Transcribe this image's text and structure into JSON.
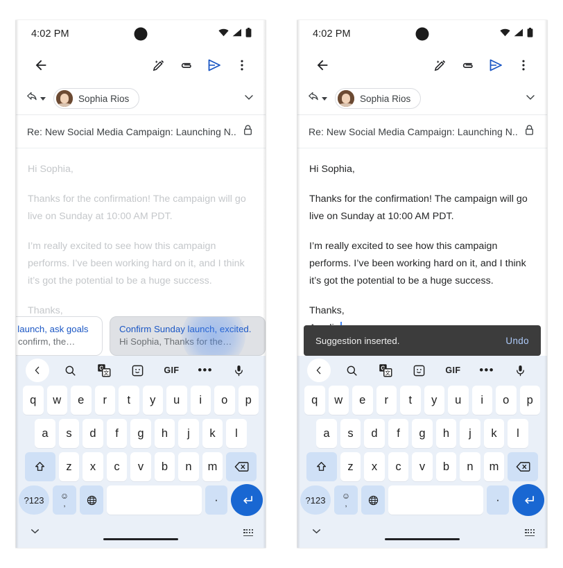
{
  "status_bar": {
    "time": "4:02 PM",
    "icons": [
      "wifi-icon",
      "cellular-signal-icon",
      "battery-icon"
    ]
  },
  "app_bar": {
    "back_icon": "arrow-back-icon",
    "actions": [
      {
        "name": "ai-compose-icon",
        "label": ""
      },
      {
        "name": "attach-file-icon",
        "label": ""
      },
      {
        "name": "send-icon",
        "label": ""
      },
      {
        "name": "more-options-icon",
        "label": ""
      }
    ]
  },
  "compose": {
    "reply_icon": "reply-icon",
    "recipient": {
      "name": "Sophia Rios",
      "avatar": "contact-avatar"
    },
    "expand_icon": "chevron-down-icon",
    "subject": "Re: New Social Media Campaign: Launching N...",
    "lock_icon": "lock-icon"
  },
  "email_body": {
    "greeting": "Hi Sophia,",
    "paragraph_1": "Thanks for the confirmation! The campaign will go live on Sunday at 10:00 AM PDT.",
    "paragraph_2": "I’m really excited to see how this campaign performs. I’ve been working hard on it, and I think it’s got the potential to be a huge success.",
    "closing": "Thanks,",
    "signature": "Amelia"
  },
  "suggestions": [
    {
      "title": "y launch, ask goals",
      "subtitle": "o confirm, the…",
      "state": "partially-visible"
    },
    {
      "title": "Confirm Sunday launch, excited.",
      "subtitle": "Hi Sophia, Thanks for the…",
      "state": "pressed"
    }
  ],
  "snackbar": {
    "message": "Suggestion inserted.",
    "action_label": "Undo"
  },
  "keyboard": {
    "toolbar": [
      {
        "name": "chevron-left-icon",
        "label": ""
      },
      {
        "name": "search-icon",
        "label": ""
      },
      {
        "name": "translate-icon",
        "label": ""
      },
      {
        "name": "sticker-icon",
        "label": ""
      },
      {
        "name": "gif-icon",
        "label": "GIF"
      },
      {
        "name": "more-horizontal-icon",
        "label": "•••"
      },
      {
        "name": "microphone-icon",
        "label": ""
      }
    ],
    "row_1": [
      "q",
      "w",
      "e",
      "r",
      "t",
      "y",
      "u",
      "i",
      "o",
      "p"
    ],
    "row_2": [
      "a",
      "s",
      "d",
      "f",
      "g",
      "h",
      "j",
      "k",
      "l"
    ],
    "row_3": [
      "z",
      "x",
      "c",
      "v",
      "b",
      "n",
      "m"
    ],
    "shift_icon": "shift-icon",
    "backspace_icon": "backspace-icon",
    "symbols_label": "?123",
    "emoji_glyph": "☺",
    "comma_glyph": ",",
    "globe_icon": "language-globe-icon",
    "space_label": "",
    "period_label": "·",
    "enter_icon": "enter-return-icon"
  },
  "nav_bar": {
    "collapse_icon": "chevron-down-icon",
    "home_indicator": "home-gesture-bar",
    "keyboard_switch_icon": "keyboard-switch-icon"
  },
  "colors": {
    "accent_blue": "#1967d2",
    "suggestion_title_blue": "#1a56c4",
    "keyboard_bg": "#eaf0f8",
    "key_mod_bg": "#cfe0f6",
    "snackbar_bg": "#3c3c3c",
    "snackbar_action": "#aecbfa",
    "faded_text": "#c4c7ca",
    "solid_text": "#232425"
  }
}
